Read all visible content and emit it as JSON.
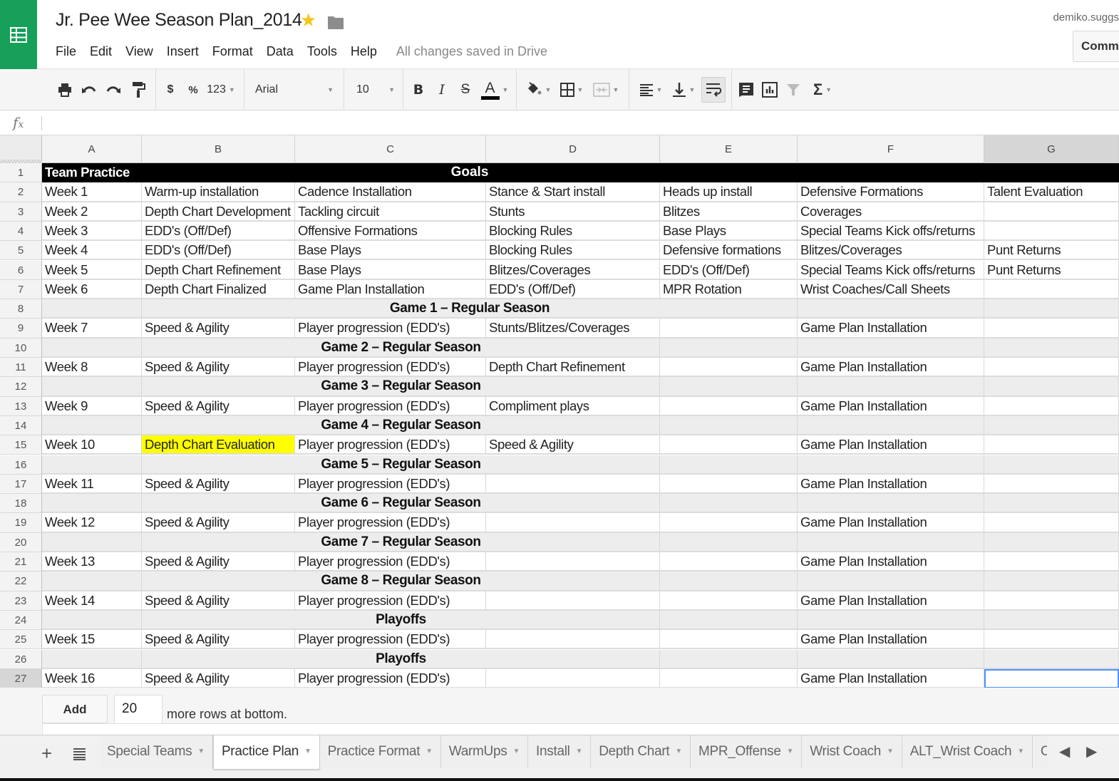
{
  "app": {
    "title": "Jr. Pee Wee Season Plan_2014",
    "save_status": "All changes saved in Drive",
    "user": "demiko.suggs",
    "comments_label": "Comments",
    "accent_color": "#16a05a"
  },
  "menu": [
    "File",
    "Edit",
    "View",
    "Insert",
    "Format",
    "Data",
    "Tools",
    "Help"
  ],
  "toolbar": {
    "currency": "$",
    "percent": "%",
    "number_format": "123",
    "font": "Arial",
    "font_size": "10",
    "bold": "B",
    "italic": "I",
    "strike": "S",
    "text_color": "A",
    "sum": "Σ"
  },
  "formula_bar": {
    "label": "fx",
    "value": ""
  },
  "columns": [
    "A",
    "B",
    "C",
    "D",
    "E",
    "F",
    "G"
  ],
  "selected_column": "G",
  "header_row": {
    "row": "1",
    "left": "Team Practice",
    "center": "Goals"
  },
  "rows": [
    {
      "n": "2",
      "type": "week",
      "cells": [
        "Week 1",
        "Warm-up installation",
        "Cadence Installation",
        "Stance & Start install",
        "Heads up install",
        "Defensive Formations",
        "Talent Evaluation"
      ]
    },
    {
      "n": "3",
      "type": "week",
      "cells": [
        "Week 2",
        "Depth Chart Development",
        "Tackling circuit",
        "Stunts",
        "Blitzes",
        "Coverages",
        ""
      ]
    },
    {
      "n": "4",
      "type": "week",
      "cells": [
        "Week 3",
        "EDD's (Off/Def)",
        "Offensive Formations",
        "Blocking Rules",
        "Base Plays",
        "Special Teams Kick offs/returns",
        ""
      ]
    },
    {
      "n": "5",
      "type": "week",
      "cells": [
        "Week 4",
        "EDD's (Off/Def)",
        "Base Plays",
        "Blocking Rules",
        "Defensive formations",
        "Blitzes/Coverages",
        "Punt Returns"
      ]
    },
    {
      "n": "6",
      "type": "week",
      "cells": [
        "Week 5",
        "Depth Chart Refinement",
        "Base Plays",
        "Blitzes/Coverages",
        "EDD's (Off/Def)",
        "Special Teams Kick offs/returns",
        "Punt Returns"
      ]
    },
    {
      "n": "7",
      "type": "week",
      "cells": [
        "Week 6",
        "Depth Chart Finalized",
        "Game Plan Installation",
        "EDD's (Off/Def)",
        "MPR Rotation",
        "Wrist Coaches/Call Sheets",
        ""
      ]
    },
    {
      "n": "8",
      "type": "band",
      "label": "Game 1 – Regular Season",
      "span": "B-E"
    },
    {
      "n": "9",
      "type": "week",
      "cells": [
        "Week 7",
        "Speed & Agility",
        "Player progression (EDD's)",
        "Stunts/Blitzes/Coverages",
        "",
        "Game Plan Installation",
        ""
      ]
    },
    {
      "n": "10",
      "type": "band",
      "label": "Game 2 – Regular Season",
      "span": "B-D"
    },
    {
      "n": "11",
      "type": "week",
      "cells": [
        "Week 8",
        "Speed & Agility",
        "Player progression (EDD's)",
        "Depth Chart Refinement",
        "",
        "Game Plan Installation",
        ""
      ]
    },
    {
      "n": "12",
      "type": "band",
      "label": "Game 3 – Regular Season",
      "span": "B-D"
    },
    {
      "n": "13",
      "type": "week",
      "cells": [
        "Week 9",
        "Speed & Agility",
        "Player progression (EDD's)",
        "Compliment plays",
        "",
        "Game Plan Installation",
        ""
      ]
    },
    {
      "n": "14",
      "type": "band",
      "label": "Game 4 – Regular Season",
      "span": "B-D"
    },
    {
      "n": "15",
      "type": "week",
      "highlight": 1,
      "cells": [
        "Week 10",
        "Depth Chart Evaluation",
        "Player progression (EDD's)",
        "Speed & Agility",
        "",
        "Game Plan Installation",
        ""
      ]
    },
    {
      "n": "16",
      "type": "band",
      "label": "Game 5 – Regular Season",
      "span": "B-D"
    },
    {
      "n": "17",
      "type": "week",
      "cells": [
        "Week 11",
        "Speed & Agility",
        "Player progression (EDD's)",
        "",
        "",
        "Game Plan Installation",
        ""
      ]
    },
    {
      "n": "18",
      "type": "band",
      "label": "Game 6 – Regular Season",
      "span": "B-D"
    },
    {
      "n": "19",
      "type": "week",
      "cells": [
        "Week 12",
        "Speed & Agility",
        "Player progression (EDD's)",
        "",
        "",
        "Game Plan Installation",
        ""
      ]
    },
    {
      "n": "20",
      "type": "band",
      "label": "Game 7 – Regular Season",
      "span": "B-D"
    },
    {
      "n": "21",
      "type": "week",
      "cells": [
        "Week 13",
        "Speed & Agility",
        "Player progression (EDD's)",
        "",
        "",
        "Game Plan Installation",
        ""
      ]
    },
    {
      "n": "22",
      "type": "band",
      "label": "Game 8 – Regular Season",
      "span": "B-D"
    },
    {
      "n": "23",
      "type": "week",
      "cells": [
        "Week 14",
        "Speed & Agility",
        "Player progression (EDD's)",
        "",
        "",
        "Game Plan Installation",
        ""
      ]
    },
    {
      "n": "24",
      "type": "band",
      "label": "Playoffs",
      "span": "B-D"
    },
    {
      "n": "25",
      "type": "week",
      "cells": [
        "Week 15",
        "Speed & Agility",
        "Player progression (EDD's)",
        "",
        "",
        "Game Plan Installation",
        ""
      ]
    },
    {
      "n": "26",
      "type": "band",
      "label": "Playoffs",
      "span": "B-D"
    },
    {
      "n": "27",
      "type": "week",
      "selected_col": 6,
      "cells": [
        "Week 16",
        "Speed & Agility",
        "Player progression (EDD's)",
        "",
        "",
        "Game Plan Installation",
        ""
      ]
    }
  ],
  "highlight_color": "#ffff00",
  "add_rows": {
    "button": "Add",
    "count": "20",
    "suffix": "more rows at bottom."
  },
  "sheet_tabs": [
    {
      "label": "Special Teams",
      "active": false
    },
    {
      "label": "Practice Plan",
      "active": true
    },
    {
      "label": "Practice Format",
      "active": false
    },
    {
      "label": "WarmUps",
      "active": false
    },
    {
      "label": "Install",
      "active": false
    },
    {
      "label": "Depth Chart",
      "active": false
    },
    {
      "label": "MPR_Offense",
      "active": false
    },
    {
      "label": "Wrist Coach",
      "active": false
    },
    {
      "label": "ALT_Wrist Coach",
      "active": false
    },
    {
      "label": "Call Sheet_O",
      "active": false
    }
  ]
}
